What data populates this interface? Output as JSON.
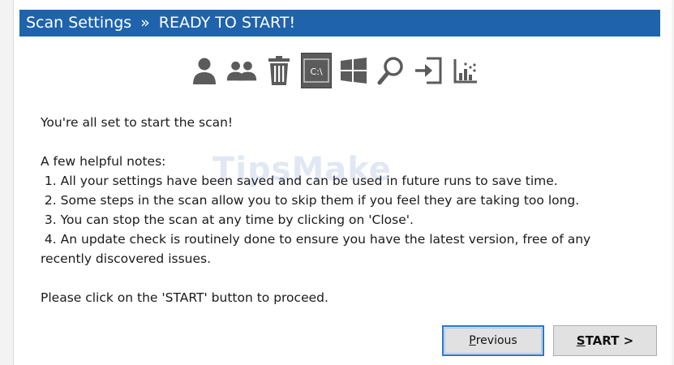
{
  "header": {
    "section": "Scan Settings",
    "separator": "»",
    "status": "READY TO START!"
  },
  "toolbar": {
    "icons": [
      {
        "name": "user-icon",
        "selected": false
      },
      {
        "name": "users-icon",
        "selected": false
      },
      {
        "name": "trash-icon",
        "selected": false
      },
      {
        "name": "command-prompt-icon",
        "label": "C:\\",
        "selected": true
      },
      {
        "name": "windows-icon",
        "selected": false
      },
      {
        "name": "search-icon",
        "selected": false
      },
      {
        "name": "login-icon",
        "selected": false
      },
      {
        "name": "chart-icon",
        "selected": false
      }
    ]
  },
  "body": {
    "intro": "You're all set to start the scan!",
    "notes_heading": "A few helpful notes:",
    "notes": [
      " 1. All your settings have been saved and can be used in future runs to save time.",
      " 2. Some steps in the scan allow you to skip them if you feel they are taking too long.",
      " 3. You can stop the scan at any time by clicking on 'Close'.",
      " 4. An update check is routinely done to ensure you have the latest version, free of any",
      "recently discovered issues."
    ],
    "closing": "Please click on the 'START' button to proceed."
  },
  "watermark": "TipsMake",
  "buttons": {
    "previous": {
      "first": "P",
      "rest": "revious"
    },
    "start": {
      "first": "S",
      "rest": "TART >"
    }
  },
  "colors": {
    "accent": "#1e63ac",
    "icon": "#5b5b5b",
    "focus": "#2a78c8"
  }
}
